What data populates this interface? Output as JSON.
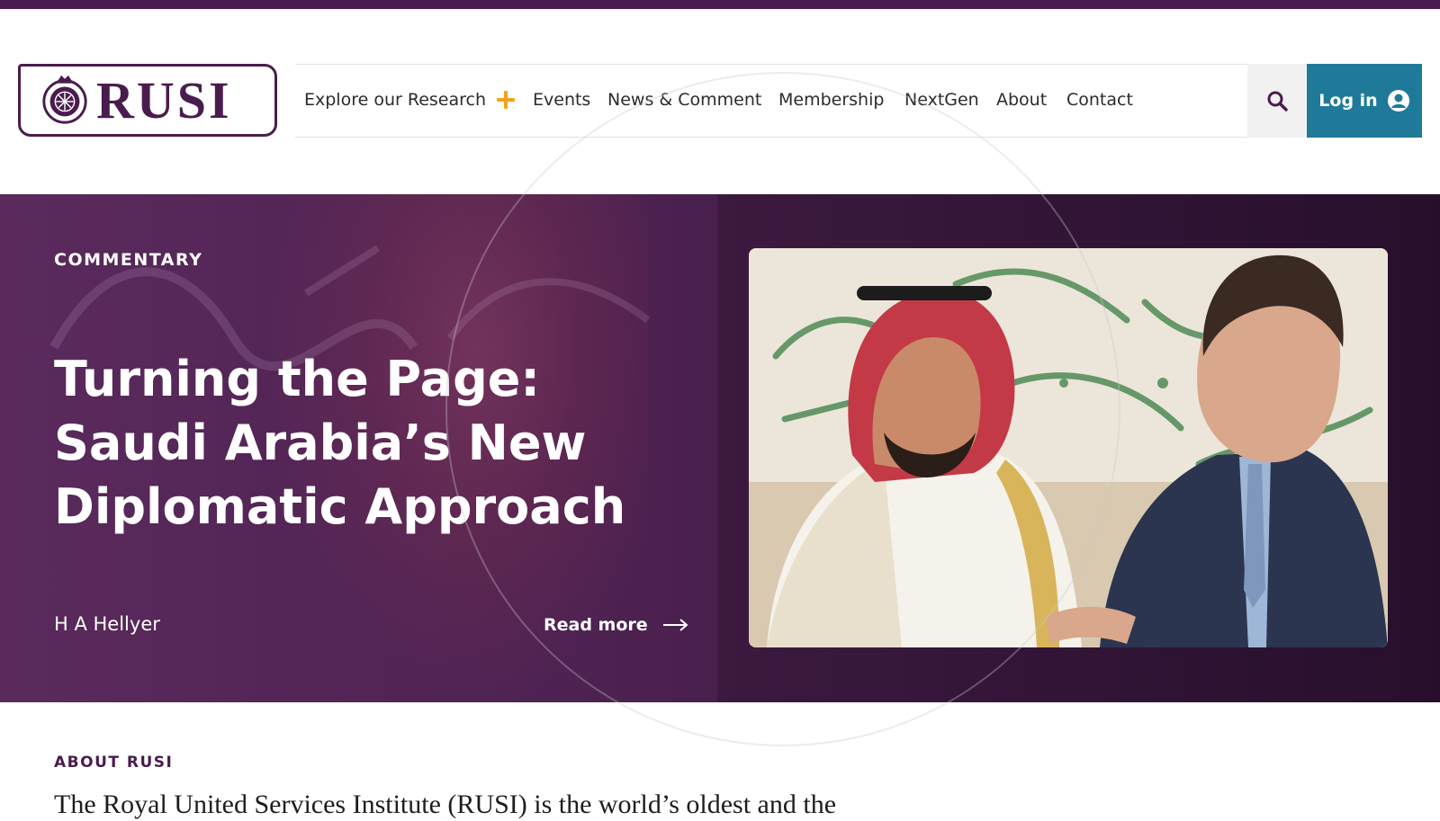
{
  "site": {
    "logo_text": "RUSI",
    "brand_color": "#4a1c4e",
    "accent_color": "#f2a31b",
    "login_color": "#1f7a9a"
  },
  "nav": {
    "items": [
      {
        "label": "Explore our Research",
        "has_plus_icon": true
      },
      {
        "label": "Events"
      },
      {
        "label": "News & Comment"
      },
      {
        "label": "Membership"
      },
      {
        "label": "NextGen"
      },
      {
        "label": "About"
      },
      {
        "label": "Contact"
      }
    ],
    "search_icon": "search-icon",
    "login_label": "Log in",
    "login_icon": "user-circle-icon"
  },
  "hero": {
    "tag": "COMMENTARY",
    "title": "Turning the Page: Saudi Arabia’s New Diplomatic Approach",
    "author": "H A Hellyer",
    "read_more": "Read more",
    "read_more_icon": "arrow-right-icon"
  },
  "about": {
    "label": "ABOUT RUSI",
    "text": "The Royal United Services Institute (RUSI) is the world’s oldest and the"
  }
}
